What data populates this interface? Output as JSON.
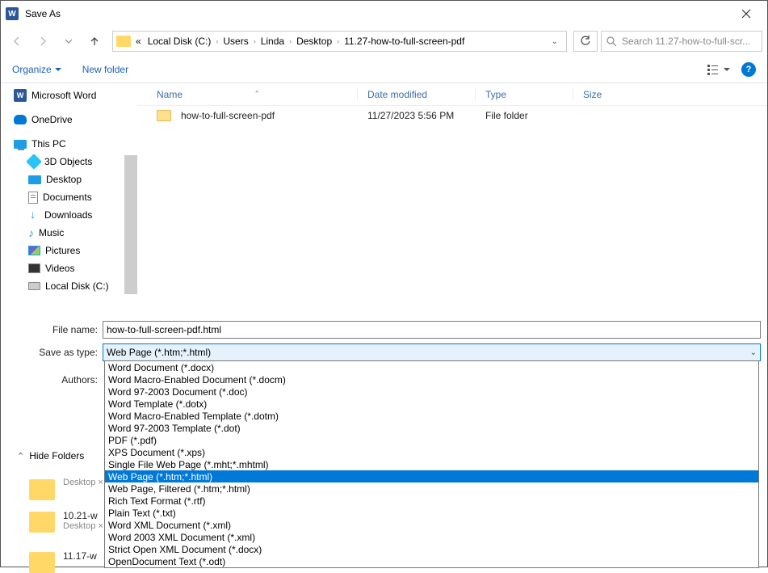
{
  "window": {
    "title": "Save As"
  },
  "nav": {
    "crumbs": [
      "Local Disk (C:)",
      "Users",
      "Linda",
      "Desktop",
      "11.27-how-to-full-screen-pdf"
    ],
    "search_placeholder": "Search 11.27-how-to-full-scr..."
  },
  "toolbar": {
    "organize": "Organize",
    "new_folder": "New folder"
  },
  "tree": {
    "items": [
      {
        "label": "Microsoft Word",
        "icon": "word"
      },
      {
        "label": "OneDrive",
        "icon": "cloud"
      },
      {
        "label": "This PC",
        "icon": "pc"
      },
      {
        "label": "3D Objects",
        "icon": "3d",
        "indent": true
      },
      {
        "label": "Desktop",
        "icon": "desk",
        "indent": true
      },
      {
        "label": "Documents",
        "icon": "doc",
        "indent": true
      },
      {
        "label": "Downloads",
        "icon": "dl",
        "indent": true
      },
      {
        "label": "Music",
        "icon": "music",
        "indent": true
      },
      {
        "label": "Pictures",
        "icon": "pic",
        "indent": true
      },
      {
        "label": "Videos",
        "icon": "vid",
        "indent": true
      },
      {
        "label": "Local Disk (C:)",
        "icon": "disk",
        "indent": true
      }
    ]
  },
  "list": {
    "headers": {
      "name": "Name",
      "date": "Date modified",
      "type": "Type",
      "size": "Size"
    },
    "rows": [
      {
        "name": "how-to-full-screen-pdf",
        "date": "11/27/2023 5:56 PM",
        "type": "File folder",
        "size": ""
      }
    ]
  },
  "fields": {
    "filename_label": "File name:",
    "filename_value": "how-to-full-screen-pdf.html",
    "type_label": "Save as type:",
    "type_value": "Web Page (*.htm;*.html)",
    "authors_label": "Authors:"
  },
  "hide_folders": "Hide Folders",
  "dropdown": {
    "selected_index": 9,
    "options": [
      "Word Document (*.docx)",
      "Word Macro-Enabled Document (*.docm)",
      "Word 97-2003 Document (*.doc)",
      "Word Template (*.dotx)",
      "Word Macro-Enabled Template (*.dotm)",
      "Word 97-2003 Template (*.dot)",
      "PDF (*.pdf)",
      "XPS Document (*.xps)",
      "Single File Web Page (*.mht;*.mhtml)",
      "Web Page (*.htm;*.html)",
      "Web Page, Filtered (*.htm;*.html)",
      "Rich Text Format (*.rtf)",
      "Plain Text (*.txt)",
      "Word XML Document (*.xml)",
      "Word 2003 XML Document (*.xml)",
      "Strict Open XML Document (*.docx)",
      "OpenDocument Text (*.odt)"
    ]
  },
  "desktop_behind": {
    "items": [
      {
        "line1": "Desktop ×",
        "line2": ""
      },
      {
        "line1": "10.21-w",
        "line2": "Desktop ×"
      },
      {
        "line1": "11.17-w",
        "line2": ""
      }
    ]
  }
}
